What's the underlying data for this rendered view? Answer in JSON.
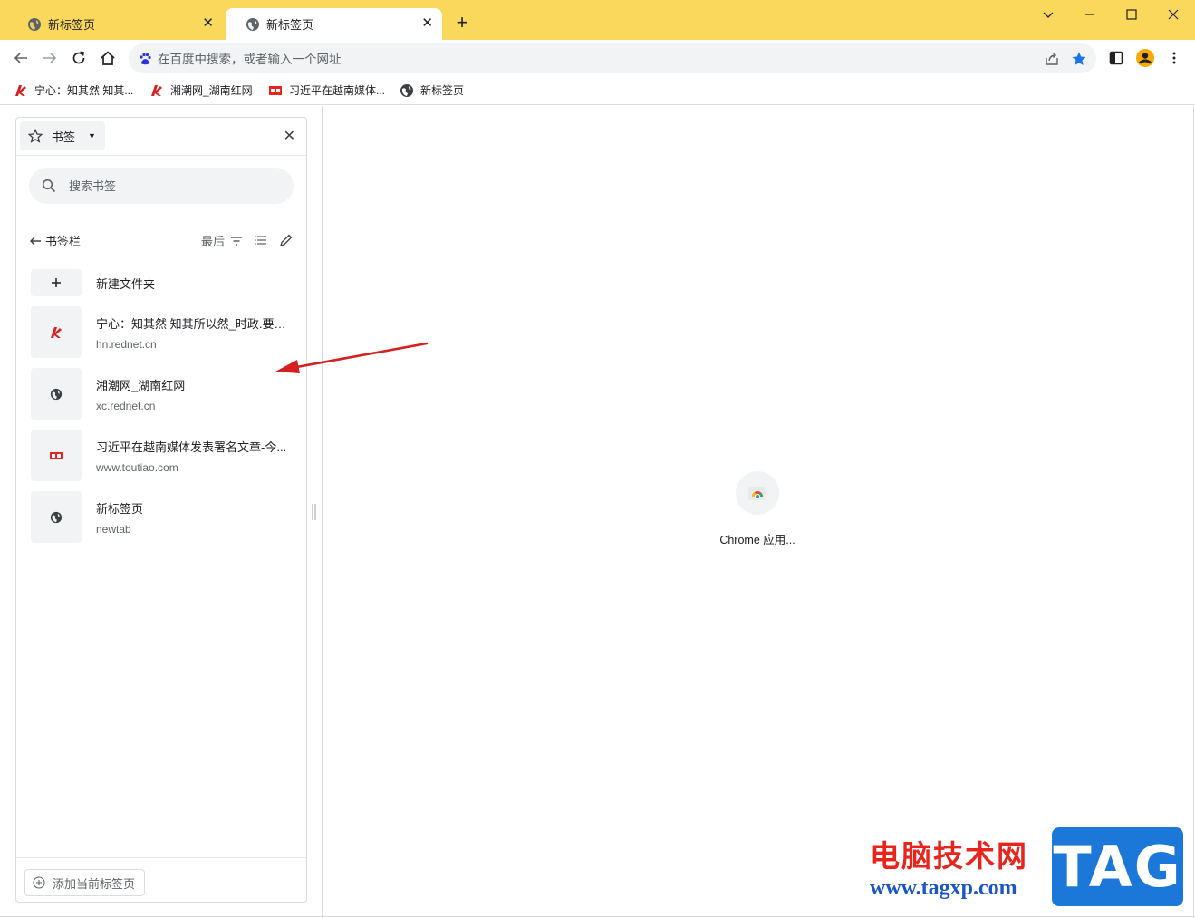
{
  "colors": {
    "titlebar": "#fad85c",
    "accent_blue": "#1a73e8",
    "annotation_arrow": "#d6201f",
    "watermark_red": "#e8251c",
    "watermark_blue": "#1a56c4"
  },
  "tabs": [
    {
      "label": "新标签页",
      "icon": "globe-icon",
      "active": false
    },
    {
      "label": "新标签页",
      "icon": "globe-icon",
      "active": true
    }
  ],
  "window_controls": {
    "dropdown": "chevron-down-icon",
    "minimize": "minimize-icon",
    "maximize": "maximize-icon",
    "close": "close-icon"
  },
  "omnibox": {
    "placeholder": "在百度中搜索，或者输入一个网址",
    "search_engine_icon": "baidu-icon"
  },
  "bookmarks_bar": [
    {
      "label": "宁心：知其然 知其...",
      "icon": "rednet-icon"
    },
    {
      "label": "湘潮网_湖南红网",
      "icon": "rednet-icon"
    },
    {
      "label": "习近平在越南媒体...",
      "icon": "toutiao-icon"
    },
    {
      "label": "新标签页",
      "icon": "globe-icon"
    }
  ],
  "side_panel": {
    "header_label": "书签",
    "search_placeholder": "搜索书签",
    "breadcrumb": "书签栏",
    "sort_label": "最后",
    "new_folder_label": "新建文件夹",
    "items": [
      {
        "title": "宁心：知其然 知其所以然_时政.要闻...",
        "url": "hn.rednet.cn",
        "icon": "rednet-icon"
      },
      {
        "title": "湘潮网_湖南红网",
        "url": "xc.rednet.cn",
        "icon": "globe-icon"
      },
      {
        "title": "习近平在越南媒体发表署名文章-今...",
        "url": "www.toutiao.com",
        "icon": "toutiao-icon"
      },
      {
        "title": "新标签页",
        "url": "newtab",
        "icon": "globe-icon"
      }
    ],
    "add_current_tab_label": "添加当前标签页"
  },
  "content": {
    "shortcut_label": "Chrome 应用...",
    "shortcut_icon": "chrome-icon"
  },
  "watermark": {
    "cn_text": "电脑技术网",
    "url_text": "www.tagxp.com",
    "badge_text": "TAG"
  }
}
